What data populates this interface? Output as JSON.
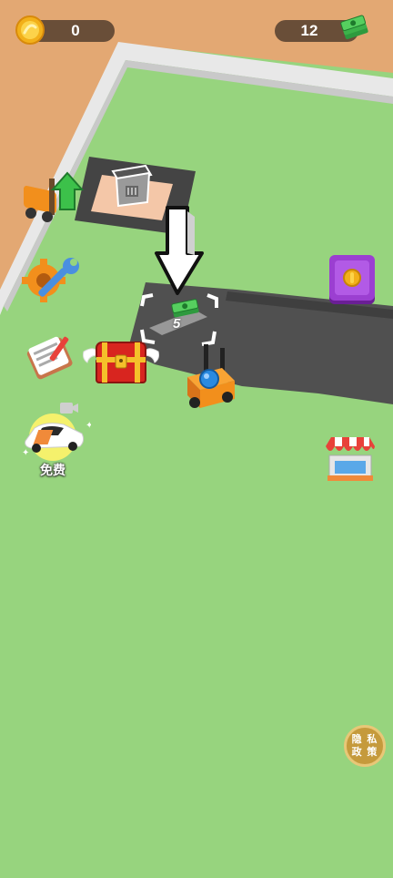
{
  "hud": {
    "coins": "0",
    "cash": "12",
    "coin_icon": "gold-coin-icon",
    "cash_icon": "cash-stack-icon"
  },
  "pad": {
    "cost": "5"
  },
  "side_buttons": {
    "free_label": "免费",
    "privacy_label": "隐 私\n政 策"
  },
  "colors": {
    "grass": "#97d47e",
    "sand": "#e3a873",
    "road": "#4a4a4a",
    "pill": "#46342a",
    "forklift_orange": "#f28f1c",
    "accent_purple": "#9b3fd1"
  }
}
